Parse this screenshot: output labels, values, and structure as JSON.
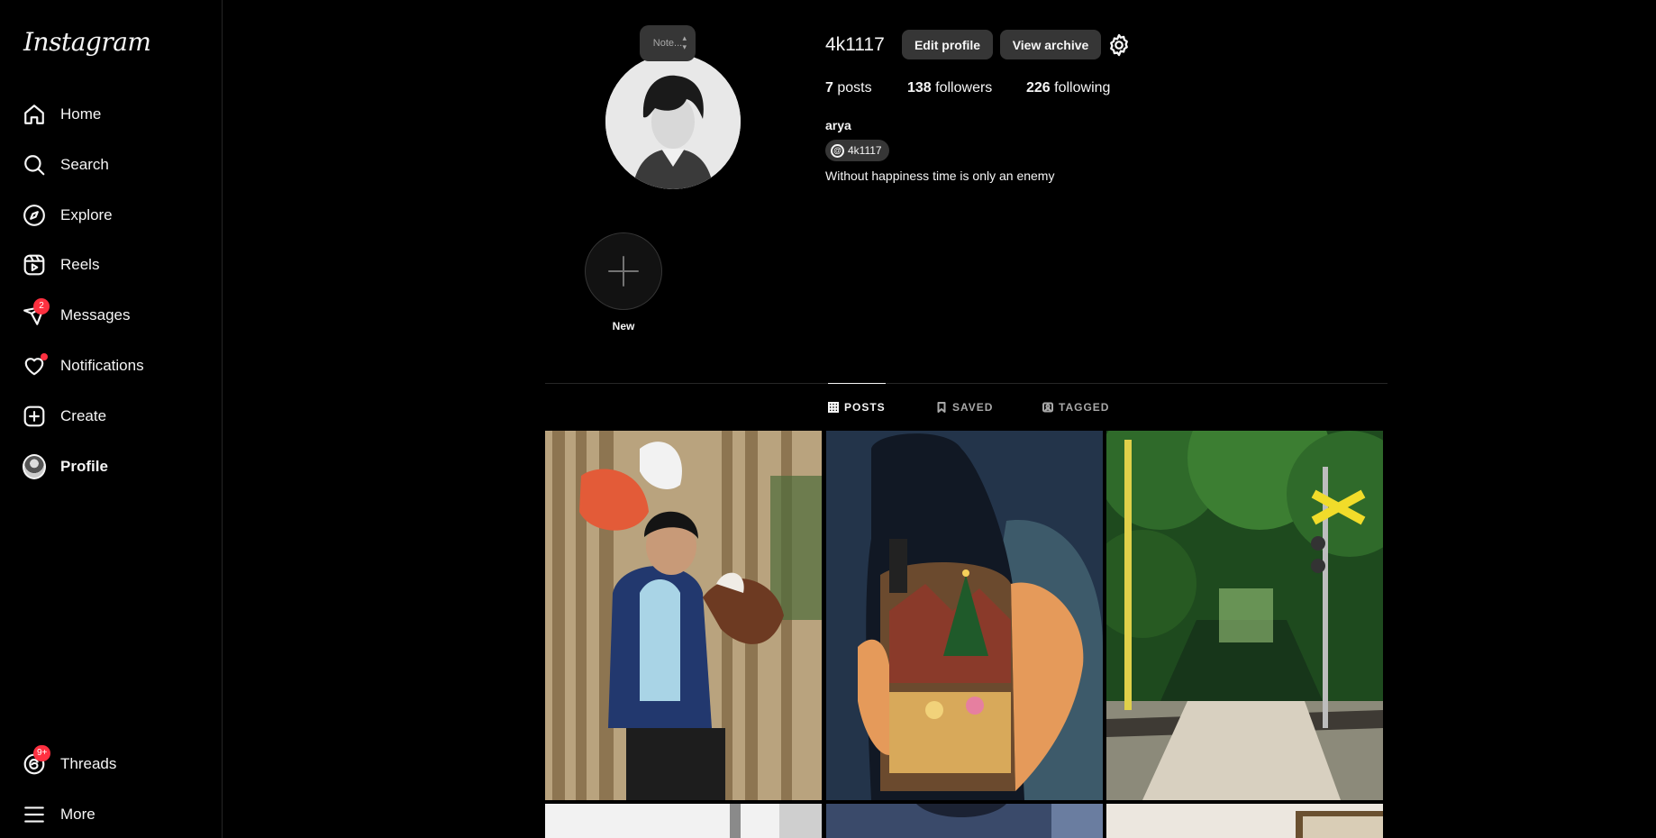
{
  "sidebar": {
    "logo": "Instagram",
    "items": [
      {
        "label": "Home",
        "icon": "home-icon"
      },
      {
        "label": "Search",
        "icon": "search-icon"
      },
      {
        "label": "Explore",
        "icon": "compass-icon"
      },
      {
        "label": "Reels",
        "icon": "reels-icon"
      },
      {
        "label": "Messages",
        "icon": "messenger-icon",
        "badge": "2"
      },
      {
        "label": "Notifications",
        "icon": "heart-icon"
      },
      {
        "label": "Create",
        "icon": "plus-square-icon"
      },
      {
        "label": "Profile",
        "icon": "avatar"
      }
    ],
    "bottom": [
      {
        "label": "Threads",
        "icon": "threads-icon",
        "badge": "9+"
      },
      {
        "label": "More",
        "icon": "menu-icon"
      }
    ]
  },
  "profile": {
    "note_placeholder": "Note...",
    "username": "4k1117",
    "edit_label": "Edit profile",
    "archive_label": "View archive",
    "posts_count": "7",
    "posts_label": "posts",
    "followers_count": "138",
    "followers_label": "followers",
    "following_count": "226",
    "following_label": "following",
    "full_name": "arya",
    "threads_handle": "4k1117",
    "bio": "Without happiness time is only an enemy"
  },
  "highlights": {
    "new_label": "New"
  },
  "tabs": [
    {
      "label": "POSTS",
      "active": true
    },
    {
      "label": "SAVED",
      "active": false
    },
    {
      "label": "TAGGED",
      "active": false
    }
  ],
  "colors": {
    "background": "#000000",
    "button": "#363636",
    "badge": "#ff3040",
    "text": "#f5f5f5",
    "muted": "#a8a8a8"
  }
}
